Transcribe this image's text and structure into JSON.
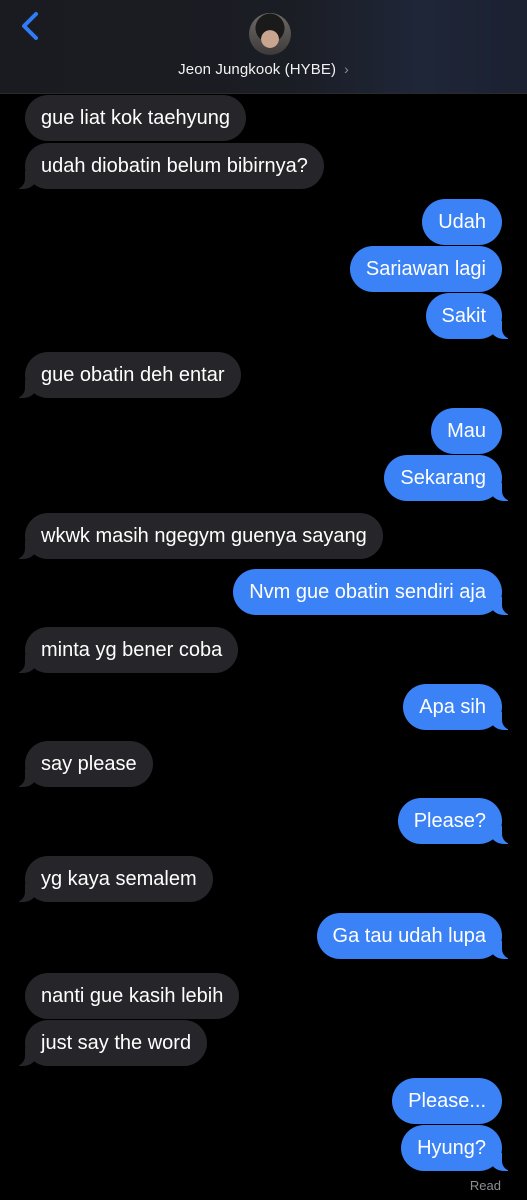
{
  "header": {
    "contact_name": "Jeon Jungkook (HYBE)",
    "chevron": "›"
  },
  "colors": {
    "incoming_bubble": "#26252a",
    "outgoing_bubble": "#3a82f6",
    "back_icon": "#2f7cf6"
  },
  "messages": [
    {
      "from": "them",
      "text": "gue liat kok taehyung"
    },
    {
      "from": "them",
      "text": "udah diobatin belum bibirnya?"
    },
    {
      "from": "me",
      "text": "Udah"
    },
    {
      "from": "me",
      "text": "Sariawan lagi"
    },
    {
      "from": "me",
      "text": "Sakit"
    },
    {
      "from": "them",
      "text": "gue obatin deh entar"
    },
    {
      "from": "me",
      "text": "Mau"
    },
    {
      "from": "me",
      "text": "Sekarang"
    },
    {
      "from": "them",
      "text": "wkwk masih ngegym guenya sayang"
    },
    {
      "from": "me",
      "text": "Nvm gue obatin sendiri aja"
    },
    {
      "from": "them",
      "text": "minta yg bener coba"
    },
    {
      "from": "me",
      "text": "Apa sih"
    },
    {
      "from": "them",
      "text": "say please"
    },
    {
      "from": "me",
      "text": "Please?"
    },
    {
      "from": "them",
      "text": "yg kaya semalem"
    },
    {
      "from": "me",
      "text": "Ga tau udah lupa"
    },
    {
      "from": "them",
      "text": "nanti gue kasih lebih"
    },
    {
      "from": "them",
      "text": "just say the word"
    },
    {
      "from": "me",
      "text": "Please..."
    },
    {
      "from": "me",
      "text": "Hyung?"
    }
  ],
  "status": {
    "read_label": "Read"
  }
}
